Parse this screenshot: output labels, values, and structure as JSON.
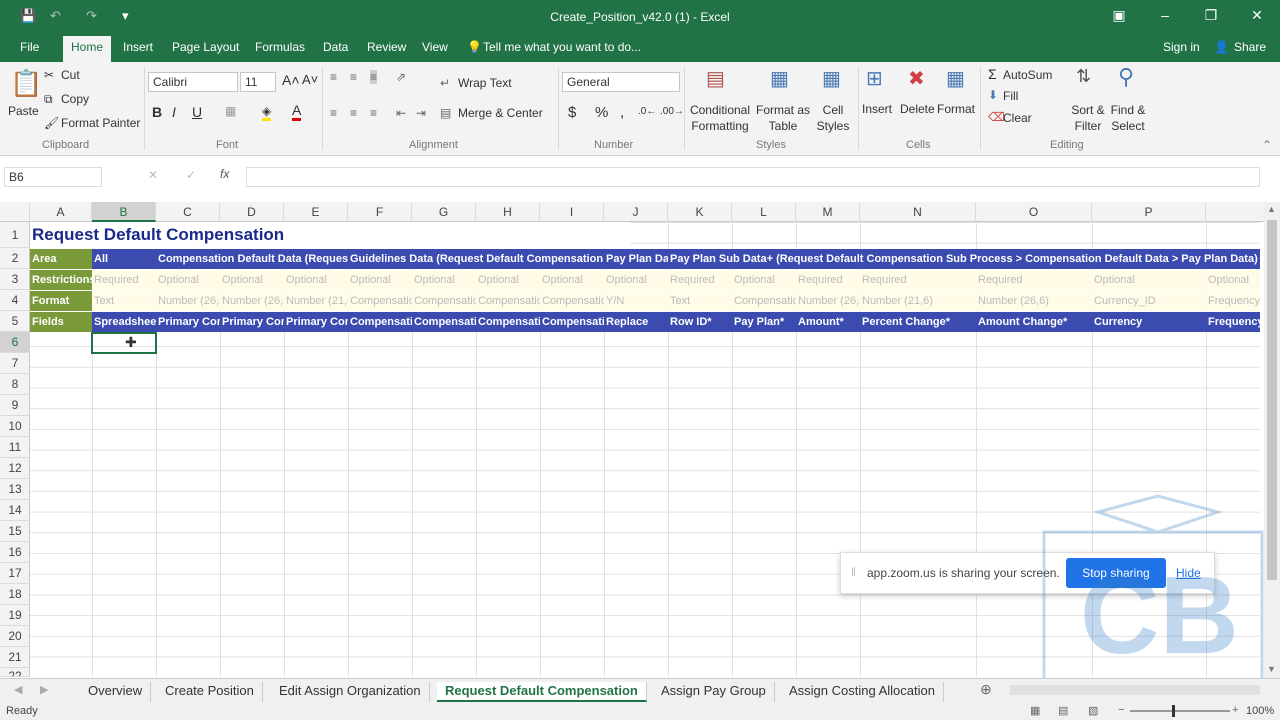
{
  "title_bar": {
    "title": "Create_Position_v42.0 (1) - Excel",
    "quick_access": [
      "save-icon",
      "undo-icon",
      "redo-icon",
      "customize-icon"
    ]
  },
  "tabs": [
    "File",
    "Home",
    "Insert",
    "Page Layout",
    "Formulas",
    "Data",
    "Review",
    "View"
  ],
  "tell_me": "Tell me what you want to do...",
  "sign_in": "Sign in",
  "share": "Share",
  "ribbon": {
    "clipboard": {
      "paste": "Paste",
      "cut": "Cut",
      "copy": "Copy",
      "format_painter": "Format Painter",
      "label": "Clipboard"
    },
    "font": {
      "name": "Calibri",
      "size": "11",
      "label": "Font"
    },
    "alignment": {
      "wrap": "Wrap Text",
      "merge": "Merge & Center",
      "label": "Alignment"
    },
    "number": {
      "format": "General",
      "label": "Number"
    },
    "styles": {
      "cond": "Conditional Formatting",
      "table": "Format as Table",
      "cell": "Cell Styles",
      "label": "Styles"
    },
    "cells": {
      "insert": "Insert",
      "delete": "Delete",
      "format": "Format",
      "label": "Cells"
    },
    "editing": {
      "autosum": "AutoSum",
      "fill": "Fill",
      "clear": "Clear",
      "sort": "Sort & Filter",
      "find": "Find & Select",
      "label": "Editing"
    }
  },
  "name_box": "B6",
  "columns": [
    "A",
    "B",
    "C",
    "D",
    "E",
    "F",
    "G",
    "H",
    "I",
    "J",
    "K",
    "L",
    "M",
    "N",
    "O",
    "P"
  ],
  "rows": [
    "1",
    "2",
    "3",
    "4",
    "5",
    "6",
    "7",
    "8",
    "9",
    "10",
    "11",
    "12",
    "13",
    "14",
    "15",
    "16",
    "17",
    "18",
    "19",
    "20",
    "21",
    "22"
  ],
  "sheet_title": "Request Default Compensation",
  "row2": {
    "area": "Area",
    "all": "All",
    "c": "Compensation Default Data (Request",
    "g": "Guidelines Data (Request Default Compensation S",
    "j": "Pay Plan Da",
    "k": "Pay Plan Sub Data+ (Request Default Compensation Sub Process > Compensation Default Data > Pay Plan Data)"
  },
  "row3": {
    "label": "Restrictions",
    "vals": [
      "Required",
      "Optional",
      "Optional",
      "Optional",
      "Optional",
      "Optional",
      "Optional",
      "Optional",
      "Optional",
      "Required",
      "Optional",
      "Required",
      "Required",
      "Required",
      "Optional",
      "Optional"
    ]
  },
  "row4": {
    "label": "Format",
    "vals": [
      "Text",
      "Number (26,6",
      "Number (26,6",
      "Number (21,6",
      "Compensatio",
      "Compensatio",
      "Compensatio",
      "Compensatio",
      "Y/N",
      "Text",
      "Compensatio",
      "Number (26,6",
      "Number (21,6)",
      "Number (26,6)",
      "Currency_ID",
      "Frequency"
    ]
  },
  "row5": {
    "label": "Fields",
    "vals": [
      "Spreadshee",
      "Primary Con",
      "Primary Con",
      "Primary Con",
      "Compensati",
      "Compensati",
      "Compensati",
      "Compensati",
      "Replace",
      "Row ID*",
      "Pay Plan*",
      "Amount*",
      "Percent Change*",
      "Amount Change*",
      "Currency",
      "Frequency"
    ]
  },
  "sheet_tabs": [
    "Overview",
    "Create Position",
    "Edit Assign Organization",
    "Request Default Compensation",
    "Assign Pay Group",
    "Assign Costing Allocation"
  ],
  "status": "Ready",
  "zoom_level": "100%",
  "zoom_popup": {
    "msg": "app.zoom.us is sharing your screen.",
    "stop": "Stop sharing",
    "hide": "Hide"
  },
  "watermark": "CB",
  "colors": {
    "excel_green": "#217346",
    "header_blue": "#3b4bb0",
    "area_green": "#7a9a3a"
  }
}
